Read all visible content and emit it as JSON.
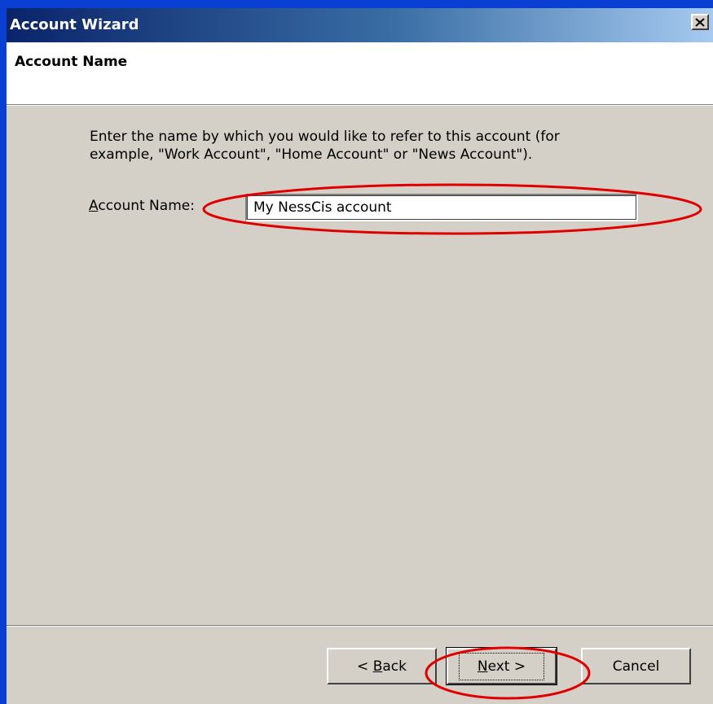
{
  "window": {
    "title": "Account Wizard"
  },
  "header": {
    "title": "Account Name"
  },
  "content": {
    "instruction_line1": "Enter the name by which you would like to refer to this account (for",
    "instruction_line2": "example, \"Work Account\", \"Home Account\" or \"News Account\").",
    "account_name_label_accel": "A",
    "account_name_label_rest": "ccount Name:",
    "account_name_value": "My NessCis account"
  },
  "buttons": {
    "back_prefix": "< ",
    "back_accel": "B",
    "back_rest": "ack",
    "next_accel": "N",
    "next_rest": "ext >",
    "cancel": "Cancel"
  },
  "colors": {
    "desktop": "#0a3fd4",
    "dialog": "#d4d0c8",
    "annotation": "#e00000"
  }
}
